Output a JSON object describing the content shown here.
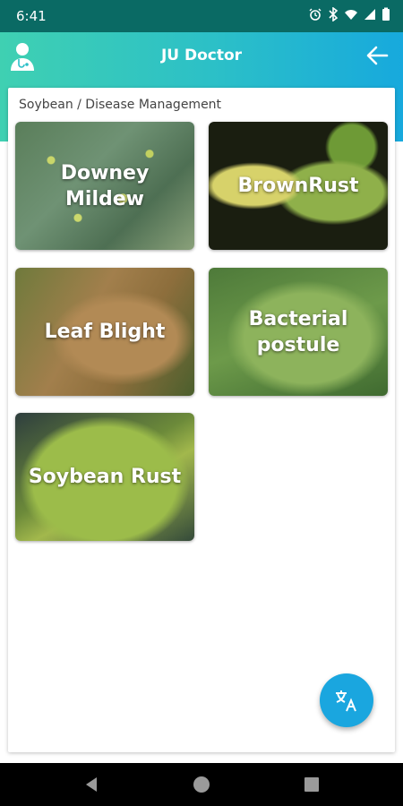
{
  "status_bar": {
    "time": "6:41",
    "icons": [
      "alarm-icon",
      "bluetooth-icon",
      "wifi-icon",
      "signal-icon",
      "battery-icon"
    ]
  },
  "app_bar": {
    "title": "JU Doctor",
    "left_icon": "doctor-icon",
    "right_icon": "back-arrow-icon",
    "gradient": [
      "#3fd0b2",
      "#17a9dd"
    ]
  },
  "breadcrumb": "Soybean / Disease Management",
  "diseases": [
    {
      "label": "Downey Mildew"
    },
    {
      "label": "BrownRust"
    },
    {
      "label": "Leaf Blight"
    },
    {
      "label": "Bacterial postule"
    },
    {
      "label": "Soybean Rust"
    }
  ],
  "fab": {
    "icon": "translate-icon",
    "color": "#1aa6df"
  },
  "nav_bar": {
    "buttons": [
      "back-icon",
      "home-icon",
      "recents-icon"
    ]
  }
}
